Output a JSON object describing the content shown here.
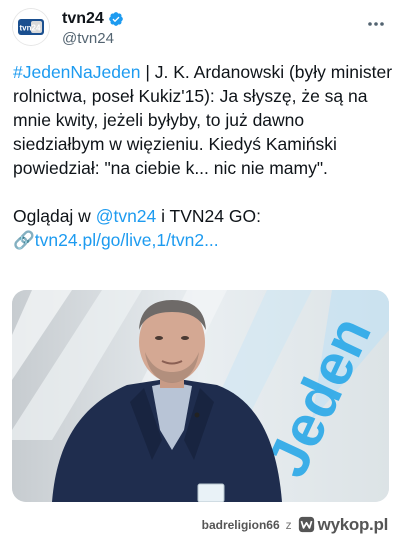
{
  "account": {
    "display_name": "tvn24",
    "handle": "@tvn24",
    "avatar_text": "tvn24",
    "verified_icon": "verified-badge-icon",
    "more_icon": "more-options-icon",
    "brand_color": "#1d9bf0"
  },
  "tweet": {
    "hashtag": "#JedenNaJeden",
    "text_after_hashtag": " | J. K. Ardanowski (były minister rolnictwa, poseł Kukiz'15): Ja słyszę, że są na mnie kwity, jeżeli byłyby, to już dawno siedziałbym w więzieniu. Kiedyś Kamiński powiedział: \"na ciebie k... nic nie mamy\".",
    "watch_prefix": "Oglądaj w ",
    "watch_mention": "@tvn24",
    "watch_suffix": " i TVN24 GO:",
    "link_icon": "🔗",
    "link_text": "tvn24.pl/go/live,1/tvn2..."
  },
  "media": {
    "background_word": "Jeden",
    "accent_color": "#2aa8e8",
    "alt_description_icon": "tv-studio-photo"
  },
  "footer": {
    "username": "badreligion66",
    "separator": "z",
    "site_name": "wykop.pl",
    "site_icon": "wykop-logo-icon"
  }
}
